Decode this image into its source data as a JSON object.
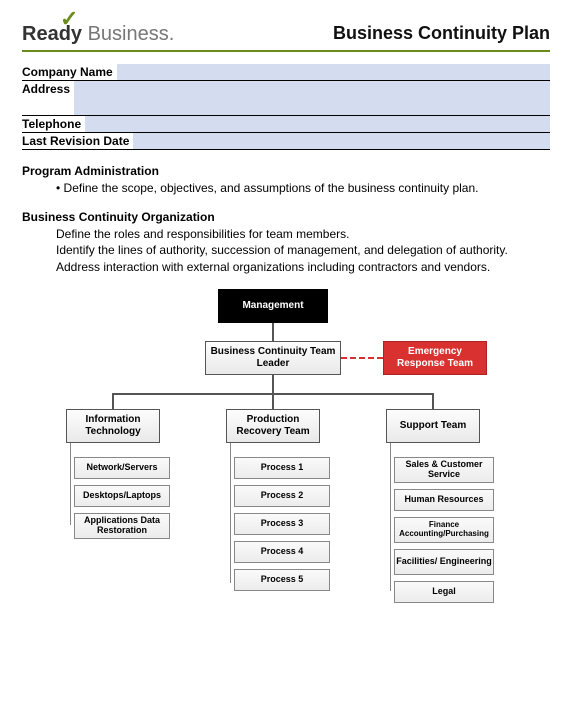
{
  "logo": {
    "ready": "Ready",
    "business": " Business."
  },
  "doc_title": "Business Continuity Plan",
  "form": {
    "company_name": {
      "label": "Company Name",
      "value": ""
    },
    "address": {
      "label": "Address",
      "value": ""
    },
    "telephone": {
      "label": "Telephone",
      "value": ""
    },
    "last_revision": {
      "label": "Last Revision Date",
      "value": ""
    }
  },
  "sections": {
    "admin": {
      "heading": "Program Administration",
      "lines": [
        "Define the scope, objectives, and assumptions of the business continuity plan."
      ]
    },
    "org": {
      "heading": "Business Continuity Organization",
      "lines": [
        "Define the roles and responsibilities for team members.",
        "Identify the lines of authority, succession of management, and delegation of authority.",
        "Address interaction with external organizations including contractors and vendors."
      ]
    }
  },
  "chart_data": {
    "type": "org-chart",
    "root": "Management",
    "second": "Business Continuity Team Leader",
    "side": "Emergency Response Team",
    "columns": [
      {
        "head": "Information Technology",
        "items": [
          "Network/Servers",
          "Desktops/Laptops",
          "Applications Data Restoration"
        ]
      },
      {
        "head": "Production Recovery Team",
        "items": [
          "Process 1",
          "Process 2",
          "Process 3",
          "Process 4",
          "Process 5"
        ]
      },
      {
        "head": "Support Team",
        "items": [
          "Sales & Customer Service",
          "Human Resources",
          "Finance Accounting/Purchasing",
          "Facilities/ Engineering",
          "Legal"
        ]
      }
    ]
  }
}
